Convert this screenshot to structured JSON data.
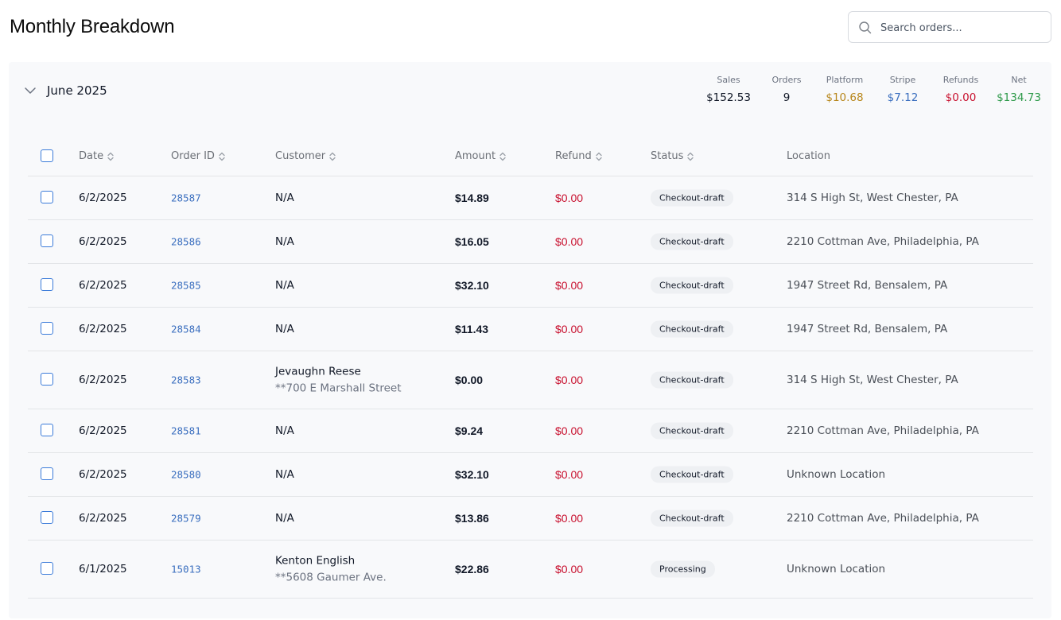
{
  "page": {
    "title": "Monthly Breakdown"
  },
  "search": {
    "placeholder": "Search orders..."
  },
  "month": {
    "label": "June 2025",
    "stats": [
      {
        "label": "Sales",
        "value": "$152.53",
        "color": "#111827"
      },
      {
        "label": "Orders",
        "value": "9",
        "color": "#111827"
      },
      {
        "label": "Platform",
        "value": "$10.68",
        "color": "#b7861a"
      },
      {
        "label": "Stripe",
        "value": "$7.12",
        "color": "#3b6fbf"
      },
      {
        "label": "Refunds",
        "value": "$0.00",
        "color": "#c8102e"
      },
      {
        "label": "Net",
        "value": "$134.73",
        "color": "#2e9a4a"
      }
    ]
  },
  "table": {
    "columns": [
      "Date",
      "Order ID",
      "Customer",
      "Amount",
      "Refund",
      "Status",
      "Location"
    ],
    "rows": [
      {
        "date": "6/2/2025",
        "order_id": "28587",
        "customer": "N/A",
        "customer_address": "",
        "amount": "$14.89",
        "refund": "$0.00",
        "status": "Checkout-draft",
        "location": "314 S High St, West Chester, PA"
      },
      {
        "date": "6/2/2025",
        "order_id": "28586",
        "customer": "N/A",
        "customer_address": "",
        "amount": "$16.05",
        "refund": "$0.00",
        "status": "Checkout-draft",
        "location": "2210 Cottman Ave, Philadelphia, PA"
      },
      {
        "date": "6/2/2025",
        "order_id": "28585",
        "customer": "N/A",
        "customer_address": "",
        "amount": "$32.10",
        "refund": "$0.00",
        "status": "Checkout-draft",
        "location": "1947 Street Rd, Bensalem, PA"
      },
      {
        "date": "6/2/2025",
        "order_id": "28584",
        "customer": "N/A",
        "customer_address": "",
        "amount": "$11.43",
        "refund": "$0.00",
        "status": "Checkout-draft",
        "location": "1947 Street Rd, Bensalem, PA"
      },
      {
        "date": "6/2/2025",
        "order_id": "28583",
        "customer": "Jevaughn Reese",
        "customer_address": "**700 E Marshall Street",
        "amount": "$0.00",
        "refund": "$0.00",
        "status": "Checkout-draft",
        "location": "314 S High St, West Chester, PA"
      },
      {
        "date": "6/2/2025",
        "order_id": "28581",
        "customer": "N/A",
        "customer_address": "",
        "amount": "$9.24",
        "refund": "$0.00",
        "status": "Checkout-draft",
        "location": "2210 Cottman Ave, Philadelphia, PA"
      },
      {
        "date": "6/2/2025",
        "order_id": "28580",
        "customer": "N/A",
        "customer_address": "",
        "amount": "$32.10",
        "refund": "$0.00",
        "status": "Checkout-draft",
        "location": "Unknown Location"
      },
      {
        "date": "6/2/2025",
        "order_id": "28579",
        "customer": "N/A",
        "customer_address": "",
        "amount": "$13.86",
        "refund": "$0.00",
        "status": "Checkout-draft",
        "location": "2210 Cottman Ave, Philadelphia, PA"
      },
      {
        "date": "6/1/2025",
        "order_id": "15013",
        "customer": "Kenton English",
        "customer_address": "**5608 Gaumer Ave.",
        "amount": "$22.86",
        "refund": "$0.00",
        "status": "Processing",
        "location": "Unknown Location"
      }
    ]
  }
}
